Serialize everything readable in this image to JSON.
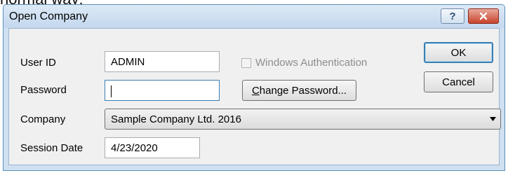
{
  "caption": {
    "text": "normal way:"
  },
  "window": {
    "title": "Open Company"
  },
  "titlebar": {
    "help_icon": "question-mark-icon",
    "close_icon": "close-icon"
  },
  "form": {
    "user_id_label": "User ID",
    "user_id_value": "ADMIN",
    "windows_auth_label": "Windows Authentication",
    "windows_auth_checked": false,
    "password_label": "Password",
    "password_value": "",
    "change_password_label": "Change Password...",
    "change_password_mnemonic": "C",
    "change_password_rest": "hange Password...",
    "company_label": "Company",
    "company_value": "Sample Company Ltd. 2016",
    "session_date_label": "Session Date",
    "session_date_value": "4/23/2020"
  },
  "buttons": {
    "ok_label": "OK",
    "cancel_label": "Cancel"
  },
  "colors": {
    "titlebar": "#c3d7ee",
    "close": "#c7432b",
    "default_border": "#3c7fb1"
  }
}
